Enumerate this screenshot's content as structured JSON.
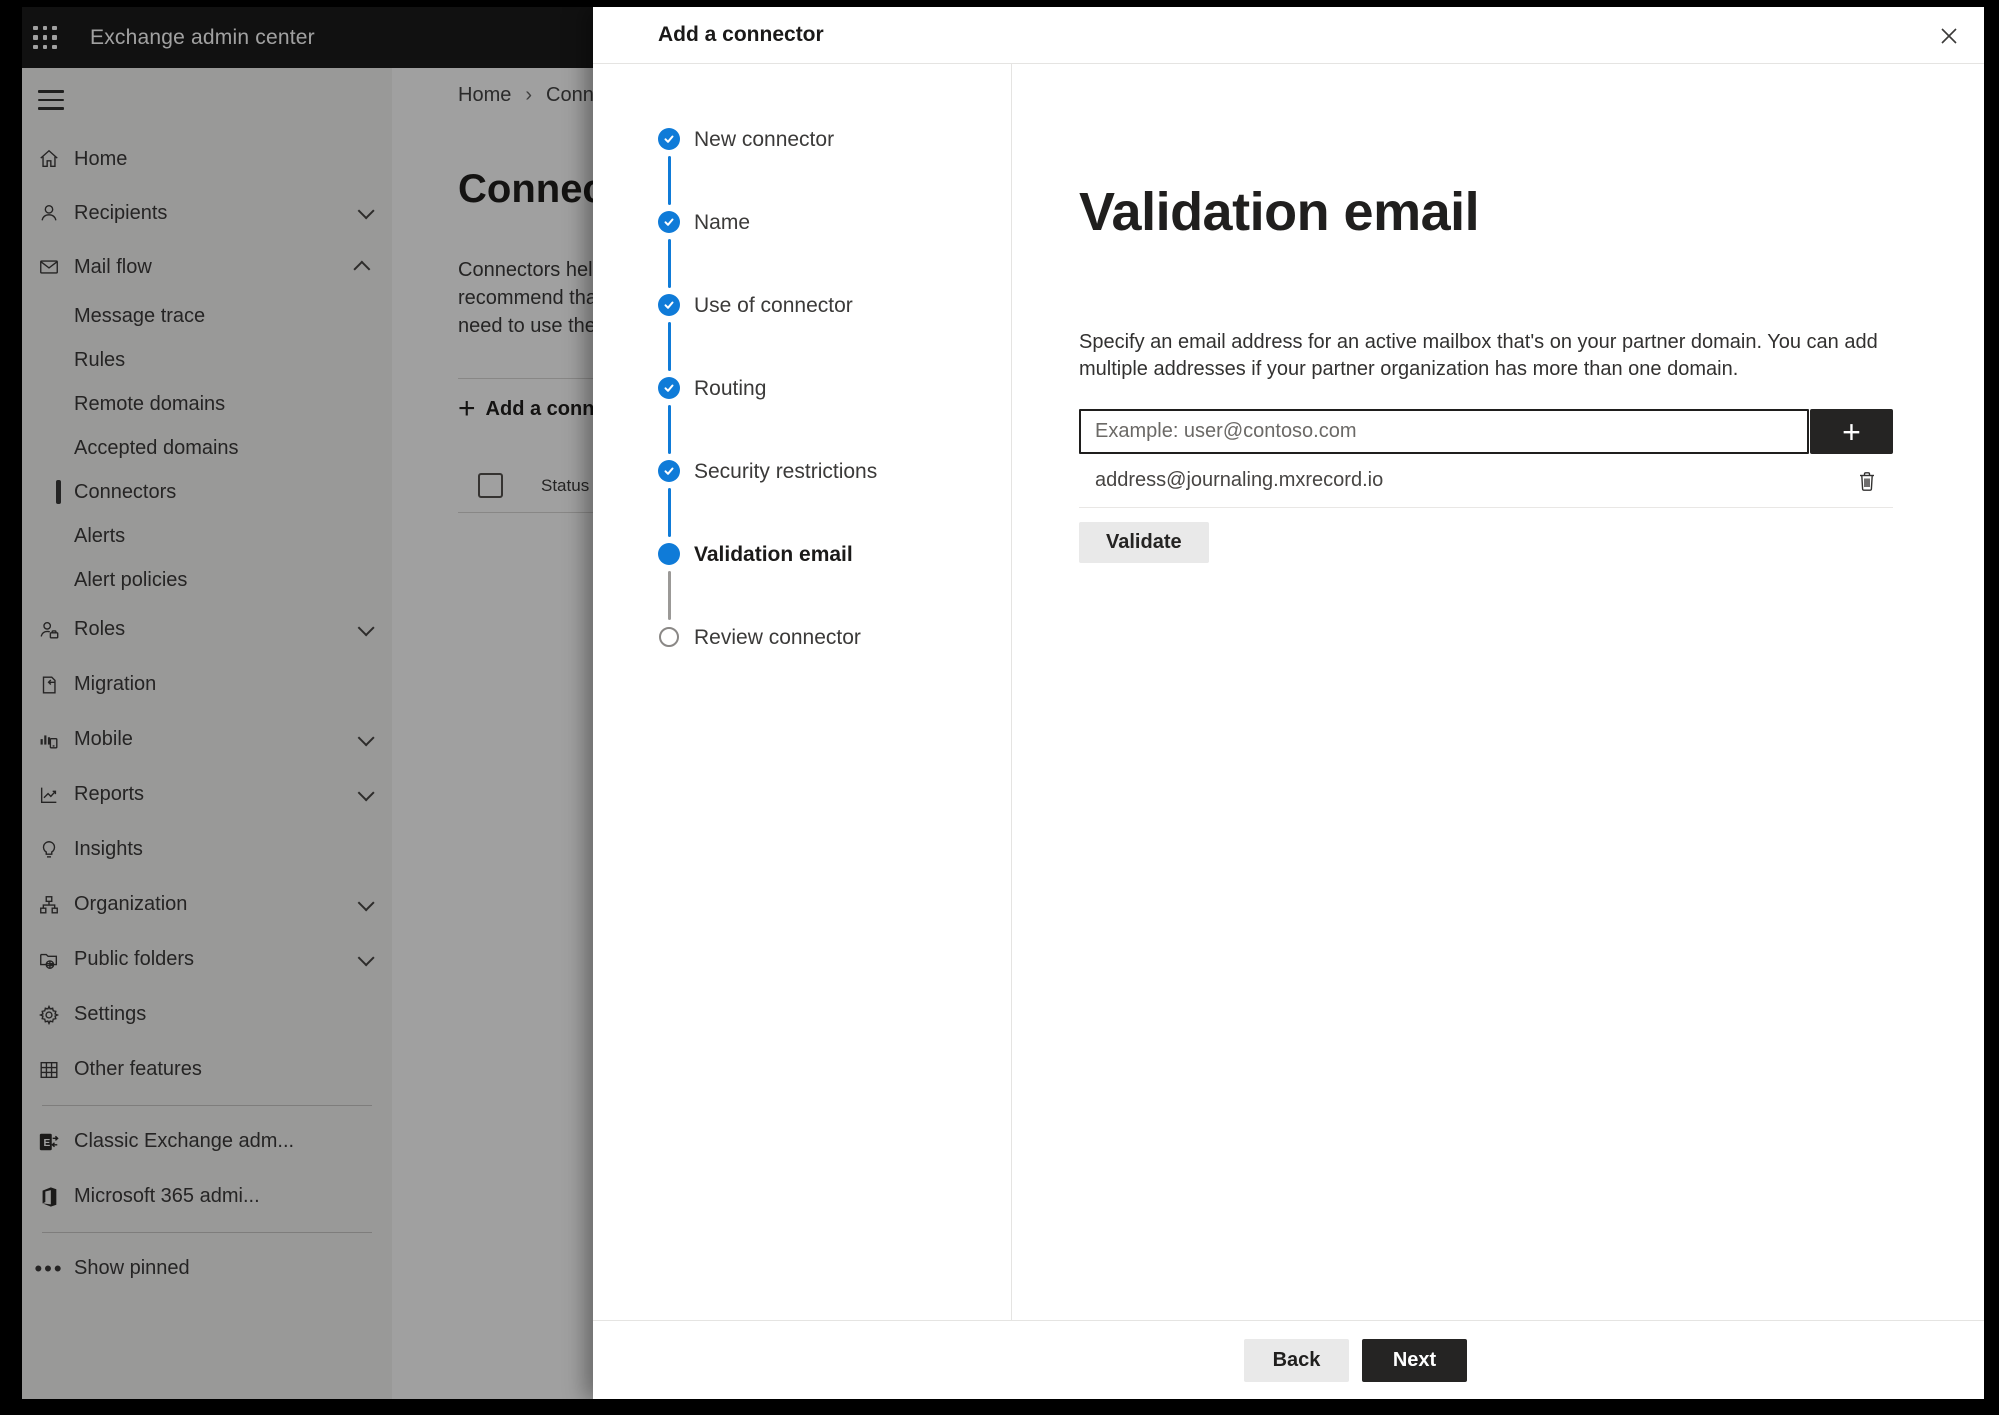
{
  "topbar": {
    "app_title": "Exchange admin center"
  },
  "sidebar": {
    "items": [
      "Home",
      "Recipients",
      "Mail flow",
      "Message trace",
      "Rules",
      "Remote domains",
      "Accepted domains",
      "Connectors",
      "Alerts",
      "Alert policies",
      "Roles",
      "Migration",
      "Mobile",
      "Reports",
      "Insights",
      "Organization",
      "Public folders",
      "Settings",
      "Other features",
      "Classic Exchange adm...",
      "Microsoft 365 admi...",
      "Show pinned"
    ]
  },
  "page": {
    "breadcrumb_home": "Home",
    "breadcrumb_current": "Conne",
    "title": "Connect",
    "description_lines": [
      "Connectors help",
      "recommend that",
      "need to use ther"
    ],
    "add_connector_button": "Add a conn",
    "status_column_header": "Status"
  },
  "panel": {
    "title": "Add a connector",
    "steps": [
      "New connector",
      "Name",
      "Use of connector",
      "Routing",
      "Security restrictions",
      "Validation email",
      "Review connector"
    ],
    "current_step": "Validation email",
    "heading": "Validation email",
    "description_lines": [
      "Specify an email address for an active mailbox that's on your partner domain. You can add",
      "multiple addresses if your partner organization has more than one domain."
    ],
    "email_input": {
      "value": "",
      "placeholder": "Example: user@contoso.com"
    },
    "added_emails": [
      "address@journaling.mxrecord.io"
    ],
    "validate_button": "Validate",
    "back_button": "Back",
    "next_button": "Next"
  },
  "colors": {
    "step_accent_blue": "#0f7bd8",
    "primary_button_dark": "#252423",
    "topbar_background": "#1b1b1b",
    "sidebar_background": "#f3f2f1"
  }
}
